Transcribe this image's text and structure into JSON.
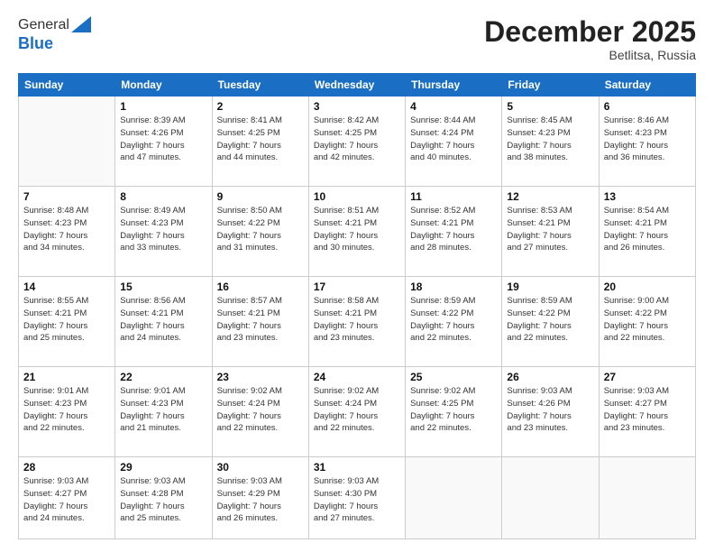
{
  "header": {
    "logo_line1": "General",
    "logo_line2": "Blue",
    "month": "December 2025",
    "location": "Betlitsa, Russia"
  },
  "weekdays": [
    "Sunday",
    "Monday",
    "Tuesday",
    "Wednesday",
    "Thursday",
    "Friday",
    "Saturday"
  ],
  "weeks": [
    [
      {
        "day": "",
        "info": ""
      },
      {
        "day": "1",
        "info": "Sunrise: 8:39 AM\nSunset: 4:26 PM\nDaylight: 7 hours\nand 47 minutes."
      },
      {
        "day": "2",
        "info": "Sunrise: 8:41 AM\nSunset: 4:25 PM\nDaylight: 7 hours\nand 44 minutes."
      },
      {
        "day": "3",
        "info": "Sunrise: 8:42 AM\nSunset: 4:25 PM\nDaylight: 7 hours\nand 42 minutes."
      },
      {
        "day": "4",
        "info": "Sunrise: 8:44 AM\nSunset: 4:24 PM\nDaylight: 7 hours\nand 40 minutes."
      },
      {
        "day": "5",
        "info": "Sunrise: 8:45 AM\nSunset: 4:23 PM\nDaylight: 7 hours\nand 38 minutes."
      },
      {
        "day": "6",
        "info": "Sunrise: 8:46 AM\nSunset: 4:23 PM\nDaylight: 7 hours\nand 36 minutes."
      }
    ],
    [
      {
        "day": "7",
        "info": "Sunrise: 8:48 AM\nSunset: 4:23 PM\nDaylight: 7 hours\nand 34 minutes."
      },
      {
        "day": "8",
        "info": "Sunrise: 8:49 AM\nSunset: 4:23 PM\nDaylight: 7 hours\nand 33 minutes."
      },
      {
        "day": "9",
        "info": "Sunrise: 8:50 AM\nSunset: 4:22 PM\nDaylight: 7 hours\nand 31 minutes."
      },
      {
        "day": "10",
        "info": "Sunrise: 8:51 AM\nSunset: 4:21 PM\nDaylight: 7 hours\nand 30 minutes."
      },
      {
        "day": "11",
        "info": "Sunrise: 8:52 AM\nSunset: 4:21 PM\nDaylight: 7 hours\nand 28 minutes."
      },
      {
        "day": "12",
        "info": "Sunrise: 8:53 AM\nSunset: 4:21 PM\nDaylight: 7 hours\nand 27 minutes."
      },
      {
        "day": "13",
        "info": "Sunrise: 8:54 AM\nSunset: 4:21 PM\nDaylight: 7 hours\nand 26 minutes."
      }
    ],
    [
      {
        "day": "14",
        "info": "Sunrise: 8:55 AM\nSunset: 4:21 PM\nDaylight: 7 hours\nand 25 minutes."
      },
      {
        "day": "15",
        "info": "Sunrise: 8:56 AM\nSunset: 4:21 PM\nDaylight: 7 hours\nand 24 minutes."
      },
      {
        "day": "16",
        "info": "Sunrise: 8:57 AM\nSunset: 4:21 PM\nDaylight: 7 hours\nand 23 minutes."
      },
      {
        "day": "17",
        "info": "Sunrise: 8:58 AM\nSunset: 4:21 PM\nDaylight: 7 hours\nand 23 minutes."
      },
      {
        "day": "18",
        "info": "Sunrise: 8:59 AM\nSunset: 4:22 PM\nDaylight: 7 hours\nand 22 minutes."
      },
      {
        "day": "19",
        "info": "Sunrise: 8:59 AM\nSunset: 4:22 PM\nDaylight: 7 hours\nand 22 minutes."
      },
      {
        "day": "20",
        "info": "Sunrise: 9:00 AM\nSunset: 4:22 PM\nDaylight: 7 hours\nand 22 minutes."
      }
    ],
    [
      {
        "day": "21",
        "info": "Sunrise: 9:01 AM\nSunset: 4:23 PM\nDaylight: 7 hours\nand 22 minutes."
      },
      {
        "day": "22",
        "info": "Sunrise: 9:01 AM\nSunset: 4:23 PM\nDaylight: 7 hours\nand 21 minutes."
      },
      {
        "day": "23",
        "info": "Sunrise: 9:02 AM\nSunset: 4:24 PM\nDaylight: 7 hours\nand 22 minutes."
      },
      {
        "day": "24",
        "info": "Sunrise: 9:02 AM\nSunset: 4:24 PM\nDaylight: 7 hours\nand 22 minutes."
      },
      {
        "day": "25",
        "info": "Sunrise: 9:02 AM\nSunset: 4:25 PM\nDaylight: 7 hours\nand 22 minutes."
      },
      {
        "day": "26",
        "info": "Sunrise: 9:03 AM\nSunset: 4:26 PM\nDaylight: 7 hours\nand 23 minutes."
      },
      {
        "day": "27",
        "info": "Sunrise: 9:03 AM\nSunset: 4:27 PM\nDaylight: 7 hours\nand 23 minutes."
      }
    ],
    [
      {
        "day": "28",
        "info": "Sunrise: 9:03 AM\nSunset: 4:27 PM\nDaylight: 7 hours\nand 24 minutes."
      },
      {
        "day": "29",
        "info": "Sunrise: 9:03 AM\nSunset: 4:28 PM\nDaylight: 7 hours\nand 25 minutes."
      },
      {
        "day": "30",
        "info": "Sunrise: 9:03 AM\nSunset: 4:29 PM\nDaylight: 7 hours\nand 26 minutes."
      },
      {
        "day": "31",
        "info": "Sunrise: 9:03 AM\nSunset: 4:30 PM\nDaylight: 7 hours\nand 27 minutes."
      },
      {
        "day": "",
        "info": ""
      },
      {
        "day": "",
        "info": ""
      },
      {
        "day": "",
        "info": ""
      }
    ]
  ]
}
